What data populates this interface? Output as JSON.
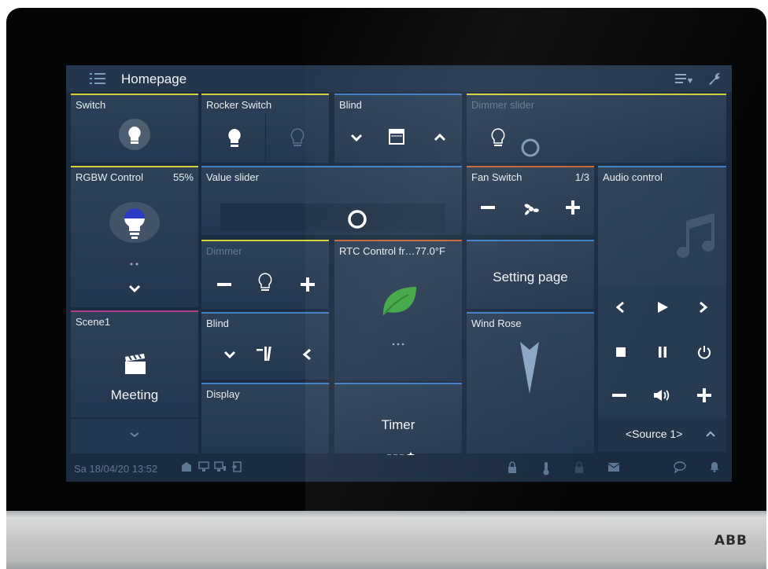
{
  "header": {
    "title": "Homepage"
  },
  "tiles": {
    "switch": {
      "label": "Switch"
    },
    "rocker": {
      "label": "Rocker Switch"
    },
    "blind1": {
      "label": "Blind"
    },
    "dimmer_slider": {
      "label": "Dimmer slider"
    },
    "rgbw": {
      "label": "RGBW Control",
      "value": "55%"
    },
    "value_slider": {
      "label": "Value slider",
      "level": 0.72
    },
    "fan": {
      "label": "Fan Switch",
      "value": "1/3"
    },
    "audio": {
      "label": "Audio control",
      "source": "<Source 1>"
    },
    "dimmer": {
      "label": "Dimmer"
    },
    "rtc": {
      "label": "RTC Control fr…77.0°F"
    },
    "setting": {
      "label": "Setting page"
    },
    "scene": {
      "label": "Scene1",
      "name": "Meeting"
    },
    "blind2": {
      "label": "Blind"
    },
    "wind": {
      "label": "Wind Rose"
    },
    "display": {
      "label": "Display"
    },
    "timer": {
      "label": "Timer"
    }
  },
  "status": {
    "datetime": "Sa 18/04/20  13:52"
  },
  "colors": {
    "yellow": "#d4d23a",
    "blue": "#3f7fc4",
    "orange": "#c9653a",
    "magenta": "#b03c8c"
  },
  "device": {
    "brand": "ABB"
  }
}
